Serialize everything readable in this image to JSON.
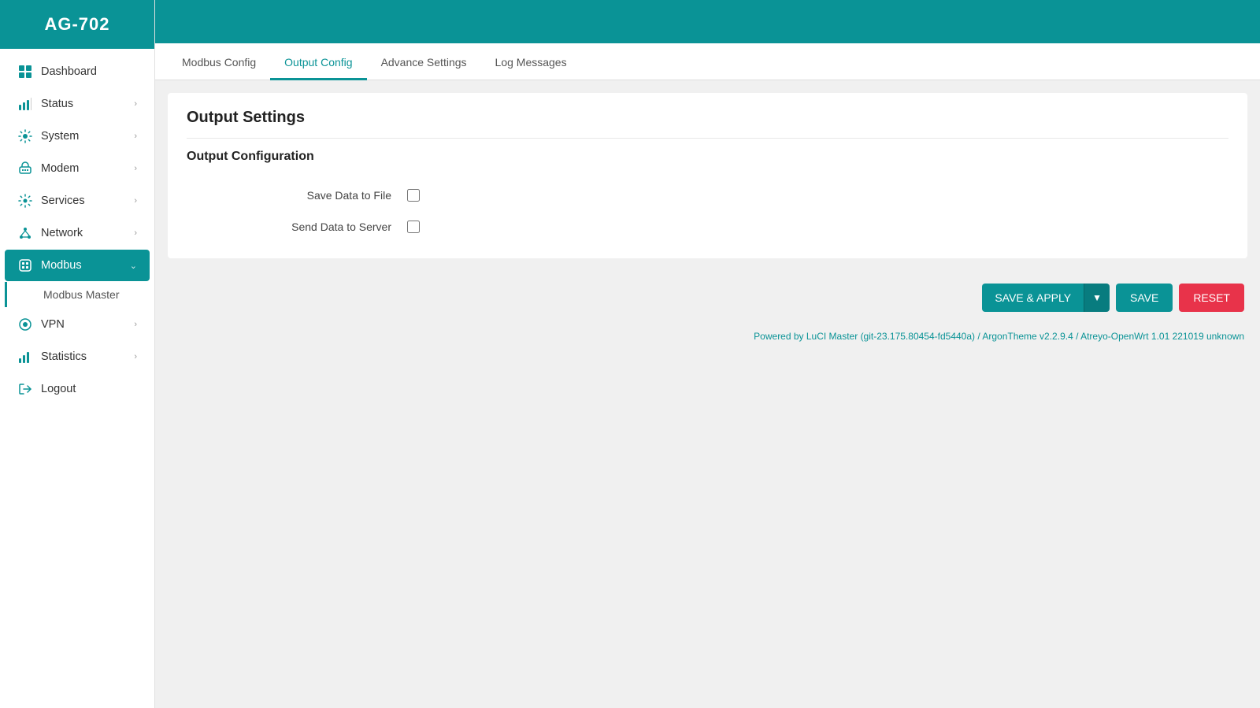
{
  "app": {
    "title": "AG-702"
  },
  "sidebar": {
    "items": [
      {
        "id": "dashboard",
        "label": "Dashboard",
        "icon": "dashboard-icon",
        "hasChevron": false,
        "active": false
      },
      {
        "id": "status",
        "label": "Status",
        "icon": "status-icon",
        "hasChevron": true,
        "active": false
      },
      {
        "id": "system",
        "label": "System",
        "icon": "system-icon",
        "hasChevron": true,
        "active": false
      },
      {
        "id": "modem",
        "label": "Modem",
        "icon": "modem-icon",
        "hasChevron": true,
        "active": false
      },
      {
        "id": "services",
        "label": "Services",
        "icon": "services-icon",
        "hasChevron": true,
        "active": false
      },
      {
        "id": "network",
        "label": "Network",
        "icon": "network-icon",
        "hasChevron": true,
        "active": false
      },
      {
        "id": "modbus",
        "label": "Modbus",
        "icon": "modbus-icon",
        "hasChevron": true,
        "active": true
      },
      {
        "id": "vpn",
        "label": "VPN",
        "icon": "vpn-icon",
        "hasChevron": true,
        "active": false
      },
      {
        "id": "statistics",
        "label": "Statistics",
        "icon": "statistics-icon",
        "hasChevron": true,
        "active": false
      },
      {
        "id": "logout",
        "label": "Logout",
        "icon": "logout-icon",
        "hasChevron": false,
        "active": false
      }
    ],
    "sub_items": [
      {
        "id": "modbus-master",
        "label": "Modbus Master"
      }
    ]
  },
  "tabs": [
    {
      "id": "modbus-config",
      "label": "Modbus Config",
      "active": false
    },
    {
      "id": "output-config",
      "label": "Output Config",
      "active": true
    },
    {
      "id": "advance-settings",
      "label": "Advance Settings",
      "active": false
    },
    {
      "id": "log-messages",
      "label": "Log Messages",
      "active": false
    }
  ],
  "page": {
    "title": "Output Settings",
    "section_title": "Output Configuration",
    "form": {
      "save_data_to_file_label": "Save Data to File",
      "send_data_to_server_label": "Send Data to Server"
    }
  },
  "actions": {
    "save_apply_label": "SAVE & APPLY",
    "save_label": "SAVE",
    "reset_label": "RESET"
  },
  "footer": {
    "text": "Powered by LuCI Master (git-23.175.80454-fd5440a) / ArgonTheme v2.2.9.4 / Atreyo-OpenWrt 1.01 221019 unknown"
  }
}
